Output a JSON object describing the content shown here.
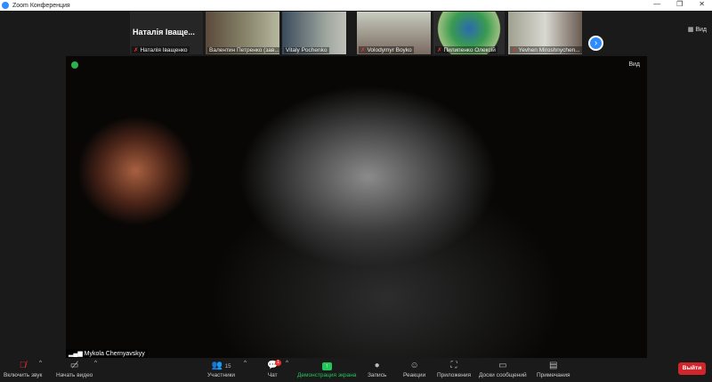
{
  "window": {
    "title": "Zoom Конференция",
    "minimize": "—",
    "maximize": "❐",
    "close": "✕"
  },
  "gallery": {
    "featured_name": "Наталія Іващe...",
    "tiles": [
      {
        "name": "Наталія Іващенко",
        "muted": true
      },
      {
        "name": "Валентин Петренко (зав...",
        "muted": false
      },
      {
        "name": "Vitaly Pochenko",
        "muted": false
      },
      {
        "name": "Volodymyr Boyko",
        "muted": true
      },
      {
        "name": "Пилипенко Олексій",
        "muted": true
      },
      {
        "name": "Yevhen Miroshnychen...",
        "muted": true
      }
    ],
    "next_icon": "›",
    "view_label": "Вид"
  },
  "main_video": {
    "speaker": "Mykola Chernyavskyy",
    "view_label": "Вид"
  },
  "toolbar": {
    "audio": "Включить звук",
    "video": "Начать видео",
    "participants": "Участники",
    "participants_count": "15",
    "chat": "Чат",
    "chat_badge": "1",
    "share": "Демонстрация экрана",
    "record": "Запись",
    "reactions": "Реакции",
    "apps": "Приложения",
    "whiteboards": "Доски сообщений",
    "notes": "Примечания",
    "leave": "Выйти"
  },
  "colors": {
    "accent": "#2d8cff",
    "share": "#23c55a",
    "leave": "#d0262b"
  }
}
